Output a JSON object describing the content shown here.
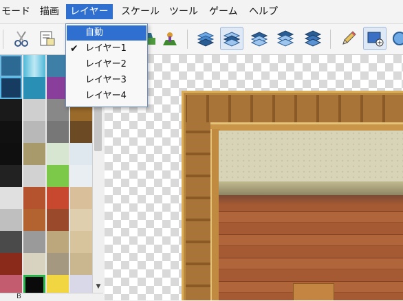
{
  "menubar": {
    "items": [
      "モード",
      "描画",
      "レイヤー",
      "スケール",
      "ツール",
      "ゲーム",
      "ヘルプ"
    ],
    "active": "レイヤー"
  },
  "toolbar": {
    "buttons": [
      "cut-icon",
      "paste-icon",
      "layer-upper-icon",
      "shadow-pen-icon",
      "layer1-icon",
      "layer2-icon",
      "layer3-icon",
      "layer4-icon",
      "layer-all-icon",
      "pencil-icon",
      "rectangle-select-icon",
      "circle-icon"
    ],
    "pressed": "layer2-icon"
  },
  "layer_menu": {
    "items": [
      {
        "label": "自動",
        "checked": false,
        "highlighted": true
      },
      {
        "label": "レイヤー1",
        "checked": true,
        "highlighted": false
      },
      {
        "label": "レイヤー2",
        "checked": false,
        "highlighted": false
      },
      {
        "label": "レイヤー3",
        "checked": false,
        "highlighted": false
      },
      {
        "label": "レイヤー4",
        "checked": false,
        "highlighted": false
      }
    ]
  },
  "palette": {
    "tab_label": "B"
  },
  "colors": {
    "accent": "#2f6fd0",
    "menubar_bg": "#f3f3f3"
  }
}
